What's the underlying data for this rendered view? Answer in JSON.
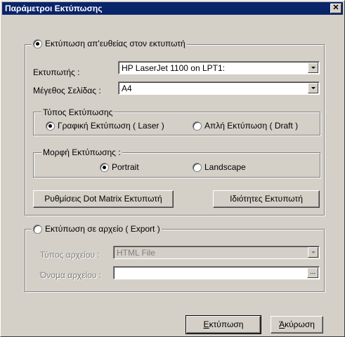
{
  "window": {
    "title": "Παράμετροι Εκτύπωσης",
    "close_label": "✕"
  },
  "direct_print": {
    "label": "Εκτύπωση απ'ευθείας στον εκτυπωτή",
    "printer_label": "Εκτυπωτής :",
    "printer_value": "HP LaserJet 1100 on LPT1:",
    "page_size_label": "Μέγεθος Σελίδας :",
    "page_size_value": "A4",
    "print_type": {
      "legend": "Τύπος Εκτύπωσης",
      "graphic_label": "Γραφική Εκτύπωση ( Laser )",
      "draft_label": "Απλή Εκτύπωση ( Draft )"
    },
    "orientation": {
      "legend": "Μορφή Εκτύπωσης :",
      "portrait_label": "Portrait",
      "landscape_label": "Landscape"
    },
    "dot_matrix_button": "Ρυθμίσεις Dot Matrix Εκτυπωτή",
    "printer_props_button": "Ιδιότητες Εκτυπωτή"
  },
  "export": {
    "label": "Εκτύπωση σε αρχείο ( Export )",
    "file_type_label": "Τύπος αρχείου :",
    "file_type_value": "HTML File",
    "file_name_label": "Όνομα αρχείου :",
    "file_name_value": "",
    "browse_label": "..."
  },
  "buttons": {
    "print_first": "Ε",
    "print_rest": "κτύπωση",
    "cancel_first": "Ά",
    "cancel_rest": "κύρωση"
  }
}
